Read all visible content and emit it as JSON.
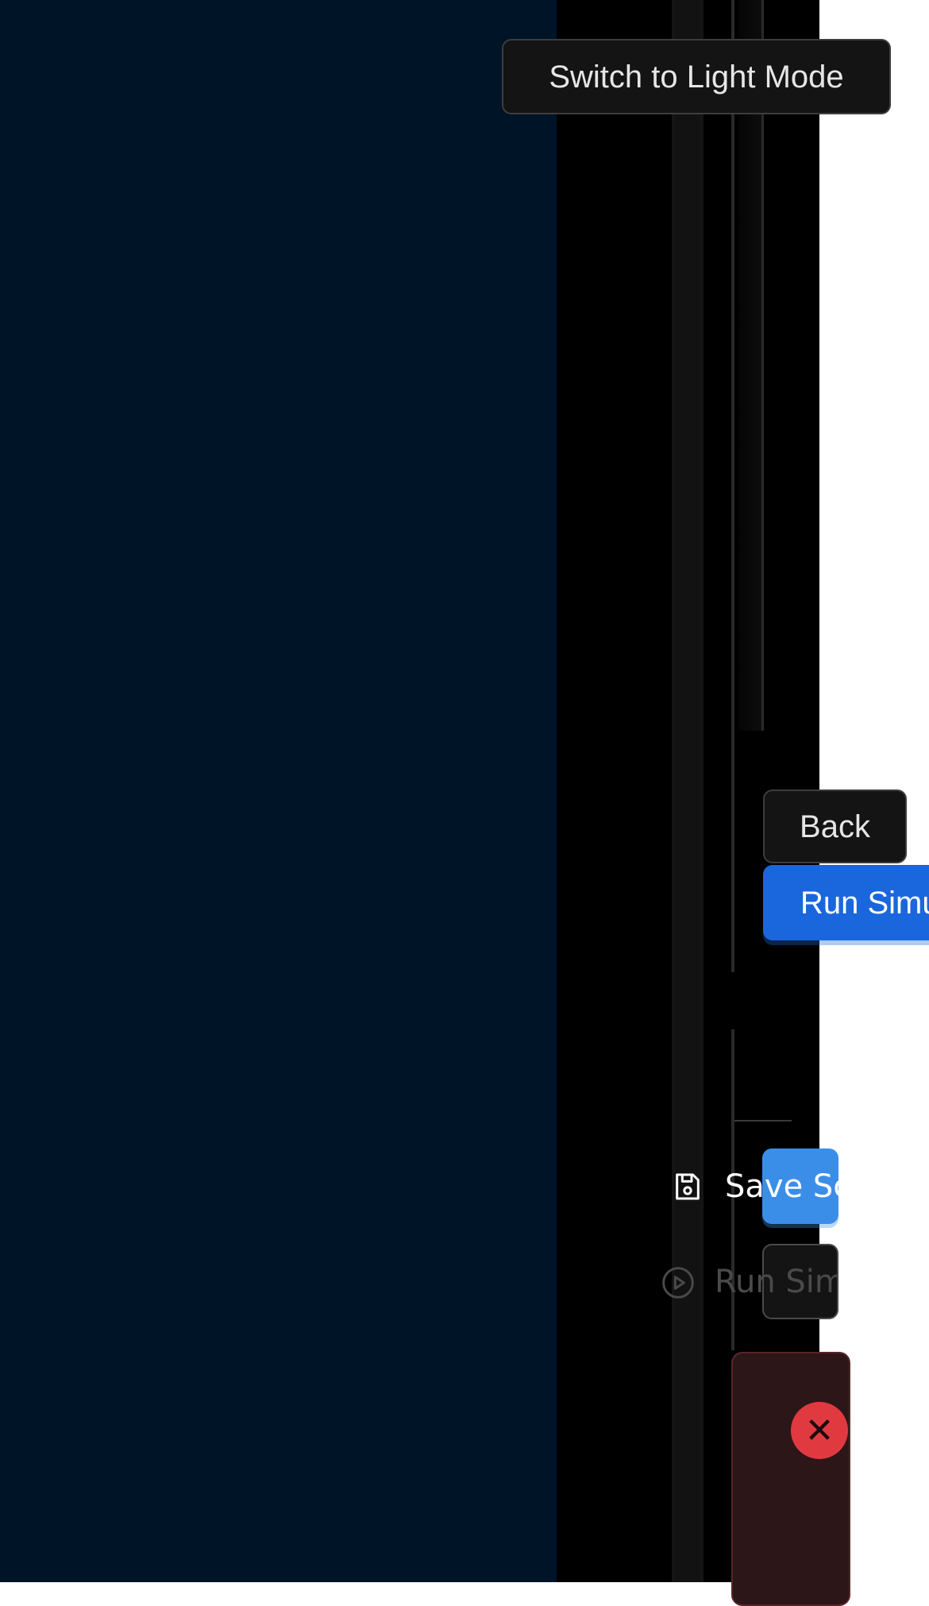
{
  "header": {
    "theme_toggle_label": "Switch to Light Mode"
  },
  "navigation": {
    "back_label": "Back",
    "run_simulation_label": "Run Simulation"
  },
  "actions": {
    "save_label": "Save Scenario",
    "run_simulation_secondary_label": "Run Simulation"
  },
  "error": {
    "close_icon_glyph": "✕",
    "accent_color": "#e03a40"
  },
  "colors": {
    "background_left": "#001428",
    "primary_button": "#1a66dd",
    "save_button": "#3b8ee8"
  },
  "icons": {
    "save": "save-icon",
    "play": "play-circle-icon",
    "close": "close-icon"
  }
}
